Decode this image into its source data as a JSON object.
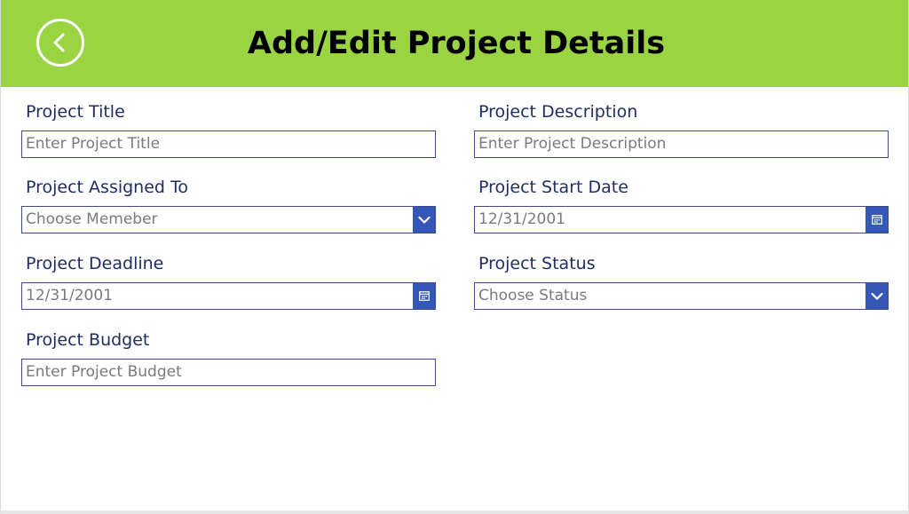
{
  "header": {
    "title": "Add/Edit Project Details",
    "back_icon": "chevron-left-circle-icon"
  },
  "colors": {
    "header_bg": "#9bd443",
    "label": "#1f2d63",
    "input_border": "#3a4a8a",
    "accent": "#3557b8",
    "placeholder": "#7a7a7a"
  },
  "form": {
    "project_title": {
      "label": "Project Title",
      "placeholder": "Enter Project Title"
    },
    "project_description": {
      "label": "Project Description",
      "placeholder": "Enter Project Description"
    },
    "project_assigned_to": {
      "label": "Project Assigned To",
      "placeholder": "Choose Memeber",
      "icon": "chevron-down-icon"
    },
    "project_start_date": {
      "label": "Project Start Date",
      "value": "12/31/2001",
      "icon": "calendar-icon"
    },
    "project_deadline": {
      "label": "Project Deadline",
      "value": "12/31/2001",
      "icon": "calendar-icon"
    },
    "project_status": {
      "label": "Project Status",
      "placeholder": "Choose Status",
      "icon": "chevron-down-icon"
    },
    "project_budget": {
      "label": "Project Budget",
      "placeholder": "Enter Project Budget"
    }
  }
}
